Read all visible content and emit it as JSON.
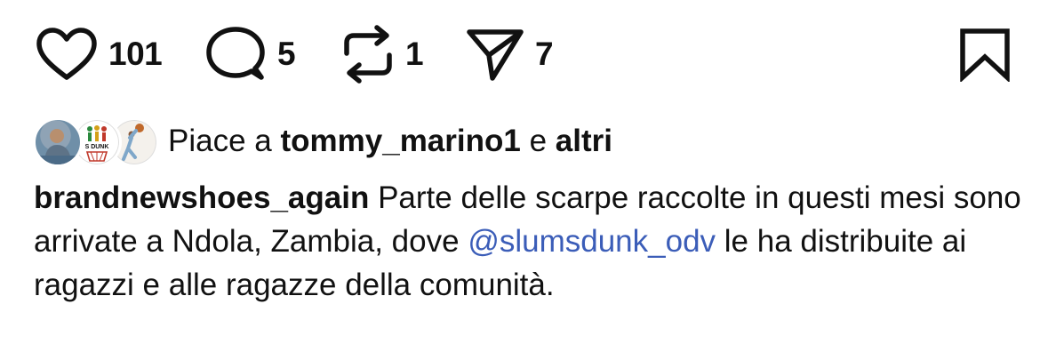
{
  "actions": {
    "like_count": "101",
    "comment_count": "5",
    "repost_count": "1",
    "share_count": "7"
  },
  "likes": {
    "prefix": "Piace a",
    "user": "tommy_marino1",
    "conjunction": "e",
    "others": "altri"
  },
  "caption": {
    "username": "brandnewshoes_again",
    "text_before_mention": "Parte delle scarpe raccolte in questi mesi sono arrivate a Ndola, Zambia, dove",
    "mention": "@slumsdunk_odv",
    "text_after_mention": "le ha distribuite ai ragazzi e alle ragazze della comunità."
  },
  "avatar_badge_text": "S DUNK",
  "icons": [
    "heart-icon",
    "comment-icon",
    "repost-icon",
    "share-icon",
    "bookmark-icon"
  ],
  "colors": {
    "text": "#111111",
    "mention": "#3b5db8",
    "background": "#ffffff"
  }
}
